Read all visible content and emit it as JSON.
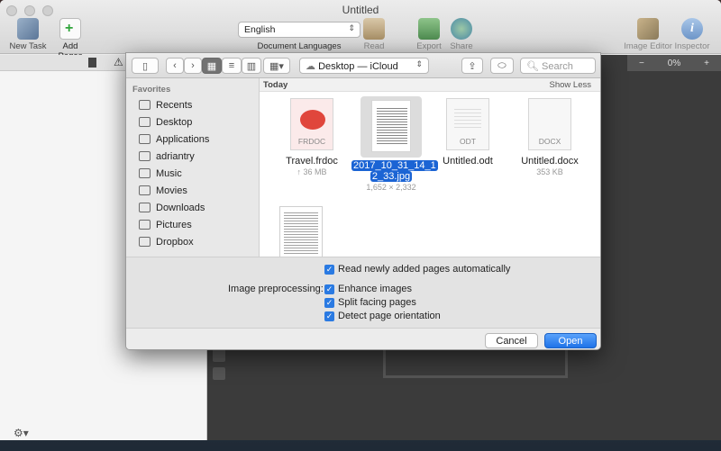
{
  "window": {
    "title": "Untitled"
  },
  "toolbar": {
    "new_task": "New Task",
    "add_pages": "Add Pages",
    "language_value": "English",
    "language_caption": "Document Languages",
    "read": "Read",
    "export": "Export",
    "share": "Share",
    "image_editor": "Image Editor",
    "inspector": "Inspector"
  },
  "right_panel": {
    "zoom": "0%",
    "minus": "−",
    "plus": "+"
  },
  "dialog": {
    "location": "Desktop — iCloud",
    "search_placeholder": "Search",
    "sidebar_heading": "Favorites",
    "sidebar_items": [
      {
        "label": "Recents",
        "icon": "recents-icon"
      },
      {
        "label": "Desktop",
        "icon": "desktop-icon"
      },
      {
        "label": "Applications",
        "icon": "applications-icon"
      },
      {
        "label": "adriantry",
        "icon": "home-icon"
      },
      {
        "label": "Music",
        "icon": "music-icon"
      },
      {
        "label": "Movies",
        "icon": "movies-icon"
      },
      {
        "label": "Downloads",
        "icon": "downloads-icon"
      },
      {
        "label": "Pictures",
        "icon": "pictures-icon"
      },
      {
        "label": "Dropbox",
        "icon": "folder-icon"
      }
    ],
    "section_label": "Today",
    "show_less": "Show Less",
    "files": [
      {
        "name": "Travel.frdoc",
        "meta": "↑ 36 MB",
        "ext": "FRDOC"
      },
      {
        "name": "2017_10_31_14_12_33.jpg",
        "name_line1": "2017_10_31_14_1",
        "name_line2": "2_33.jpg",
        "meta": "1,652 × 2,332"
      },
      {
        "name": "Untitled.odt",
        "meta": "",
        "ext": "ODT"
      },
      {
        "name": "Untitled.docx",
        "meta": "353 KB",
        "ext": "DOCX"
      }
    ],
    "options": {
      "read_auto": "Read newly added pages automatically",
      "preprocessing_label": "Image preprocessing:",
      "enhance": "Enhance images",
      "split": "Split facing pages",
      "detect": "Detect page orientation"
    },
    "cancel": "Cancel",
    "open": "Open"
  }
}
